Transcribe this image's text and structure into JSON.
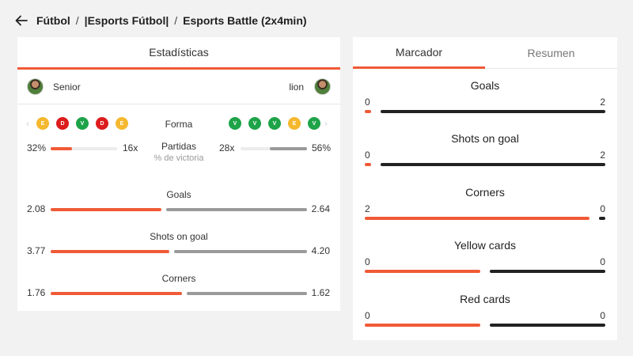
{
  "breadcrumb": {
    "items": [
      "Fútbol",
      "|Esports Fútbol|",
      "Esports Battle (2x4min)"
    ],
    "separator": "/"
  },
  "stats_card": {
    "title": "Estadísticas",
    "home_player": "Senior",
    "away_player": "lion",
    "form": {
      "label": "Forma",
      "home": [
        "E",
        "D",
        "V",
        "D",
        "E"
      ],
      "away": [
        "V",
        "V",
        "V",
        "E",
        "V"
      ]
    },
    "matches": {
      "label": "Partidas",
      "sublabel": "% de victoria",
      "home_pct": "32%",
      "home_count": "16x",
      "away_count": "28x",
      "away_pct": "56%",
      "home_fraction": 0.32,
      "away_fraction": 0.56
    },
    "stats": [
      {
        "title": "Goals",
        "home": "2.08",
        "away": "2.64",
        "home_value": 2.08,
        "away_value": 2.64
      },
      {
        "title": "Shots on goal",
        "home": "3.77",
        "away": "4.20",
        "home_value": 3.77,
        "away_value": 4.2
      },
      {
        "title": "Corners",
        "home": "1.76",
        "away": "1.62",
        "home_value": 1.76,
        "away_value": 1.62
      }
    ]
  },
  "score_card": {
    "tabs": [
      "Marcador",
      "Resumen"
    ],
    "active_tab": 0,
    "rows": [
      {
        "title": "Goals",
        "home": "0",
        "away": "2",
        "home_value": 0,
        "away_value": 2
      },
      {
        "title": "Shots on goal",
        "home": "0",
        "away": "2",
        "home_value": 0,
        "away_value": 2
      },
      {
        "title": "Corners",
        "home": "2",
        "away": "0",
        "home_value": 2,
        "away_value": 0
      },
      {
        "title": "Yellow cards",
        "home": "0",
        "away": "0",
        "home_value": 0,
        "away_value": 0
      },
      {
        "title": "Red cards",
        "home": "0",
        "away": "0",
        "home_value": 0,
        "away_value": 0
      }
    ]
  },
  "colors": {
    "accent": "#f05a36",
    "away_stat": "#9a9a9a",
    "away_score": "#222222",
    "form_win": "#1ea348",
    "form_draw": "#f5b82e",
    "form_loss": "#dd1c1c"
  }
}
